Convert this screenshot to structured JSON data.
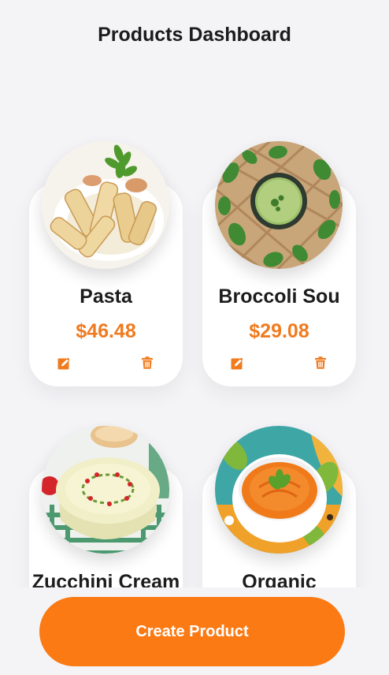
{
  "header": {
    "title": "Products Dashboard"
  },
  "products": [
    {
      "name": "Pasta",
      "price": "$46.48"
    },
    {
      "name": "Broccoli Sou",
      "price": "$29.08"
    },
    {
      "name": "Zucchini Cream",
      "price": ""
    },
    {
      "name": "Organic",
      "price": ""
    }
  ],
  "icons": {
    "edit": "edit-icon",
    "delete": "trash-icon"
  },
  "colors": {
    "accent": "#f07b1f",
    "button": "#fb7a14",
    "background": "#f4f4f7"
  },
  "footer": {
    "create_label": "Create Product"
  }
}
